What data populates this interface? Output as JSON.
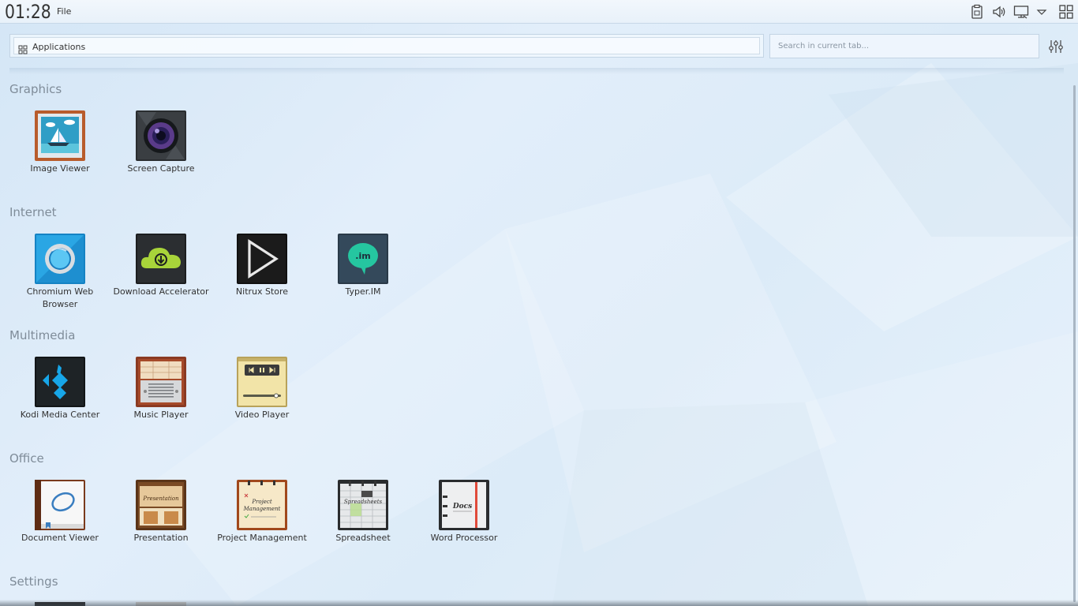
{
  "topbar": {
    "clock": "01:28",
    "menu_file": "File"
  },
  "toolbar": {
    "apps_label": "Applications",
    "search_placeholder": "Search in current tab..."
  },
  "sections": {
    "graphics": {
      "title": "Graphics",
      "apps": [
        {
          "label": "Image Viewer"
        },
        {
          "label": "Screen Capture"
        }
      ]
    },
    "internet": {
      "title": "Internet",
      "apps": [
        {
          "label": "Chromium Web Browser"
        },
        {
          "label": "Download Accelerator"
        },
        {
          "label": "Nitrux Store"
        },
        {
          "label": "Typer.IM"
        }
      ]
    },
    "multimedia": {
      "title": "Multimedia",
      "apps": [
        {
          "label": "Kodi Media Center"
        },
        {
          "label": "Music Player"
        },
        {
          "label": "Video Player"
        }
      ]
    },
    "office": {
      "title": "Office",
      "apps": [
        {
          "label": "Document Viewer"
        },
        {
          "label": "Presentation"
        },
        {
          "label": "Project Management"
        },
        {
          "label": "Spreadsheet"
        },
        {
          "label": "Word Processor"
        }
      ]
    },
    "settings": {
      "title": "Settings"
    }
  },
  "icons": {
    "tray": [
      "clipboard-icon",
      "volume-icon",
      "display-icon",
      "chevron-down-icon",
      "app-grid-icon"
    ]
  },
  "colors": {
    "section_title": "#7f8c99",
    "text": "#333333",
    "accent_green": "#a8d43a",
    "accent_teal": "#25c6a0"
  }
}
